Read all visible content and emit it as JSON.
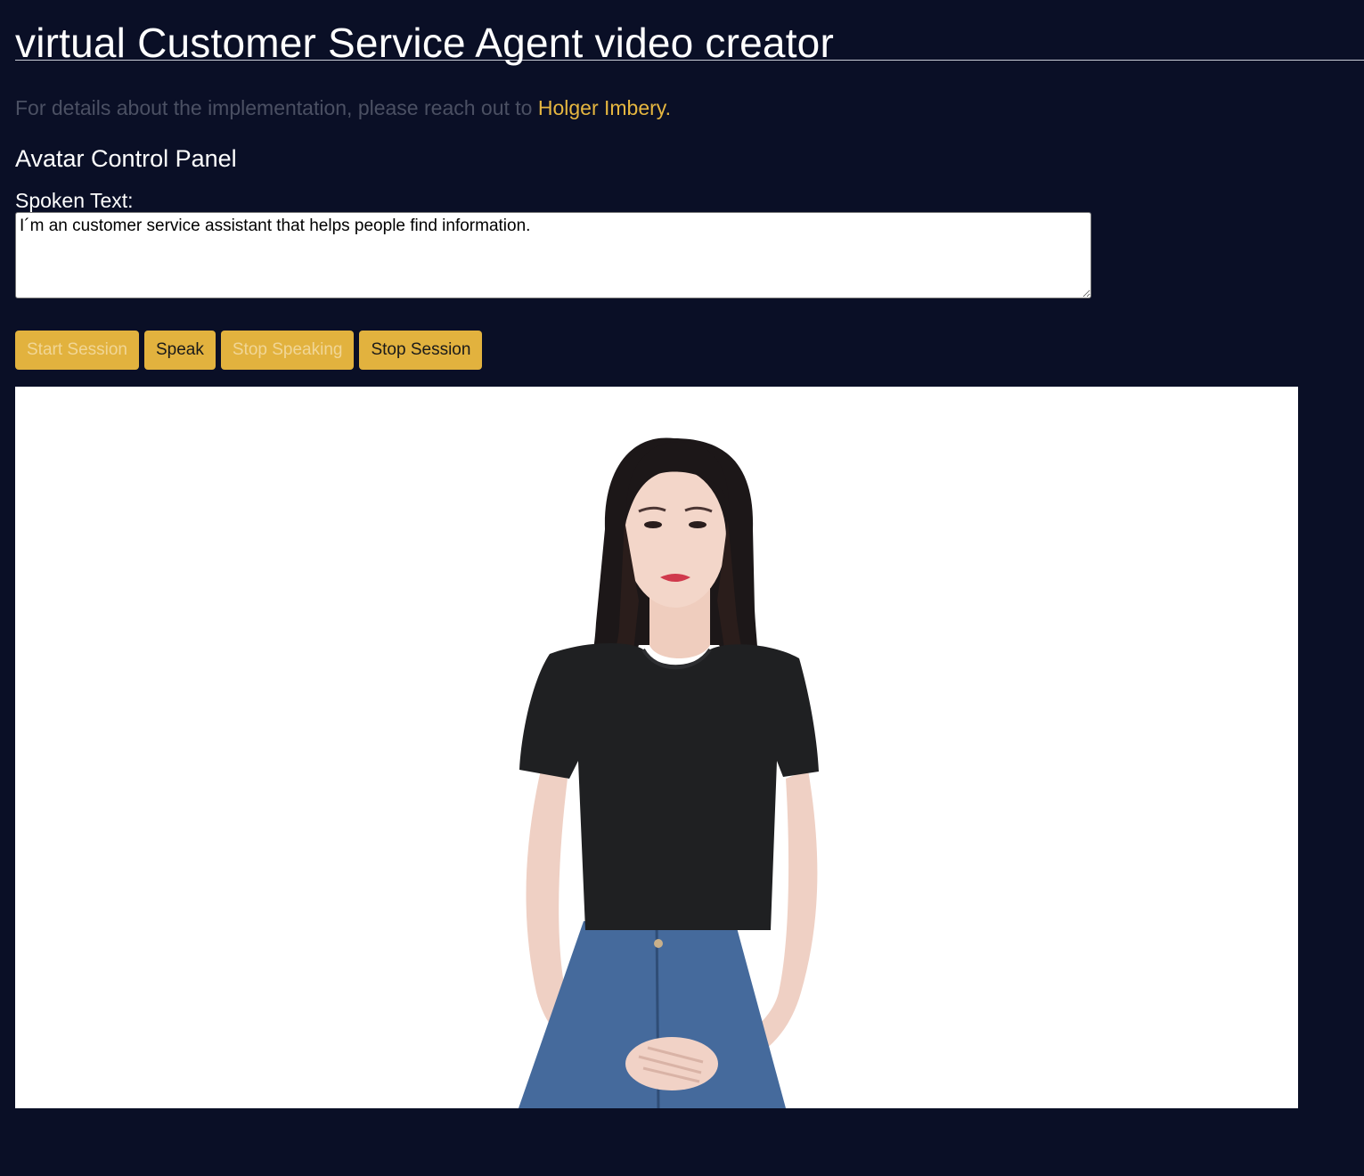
{
  "header": {
    "title": "virtual Customer Service Agent video creator"
  },
  "intro": {
    "text": "For details about the implementation, please reach out to ",
    "contact_name": "Holger Imbery."
  },
  "control_panel": {
    "heading": "Avatar Control Panel",
    "spoken_text_label": "Spoken Text:",
    "spoken_text_value": "I´m an customer service assistant that helps people find information."
  },
  "buttons": {
    "start_session": {
      "label": "Start Session",
      "enabled": false
    },
    "speak": {
      "label": "Speak",
      "enabled": true
    },
    "stop_speaking": {
      "label": "Stop Speaking",
      "enabled": false
    },
    "stop_session": {
      "label": "Stop Session",
      "enabled": true
    }
  },
  "video": {
    "content": "avatar-video",
    "background": "#ffffff"
  },
  "colors": {
    "page_background": "#0a0f26",
    "accent": "#e2b23e",
    "link": "#e6b740",
    "muted_text": "#4b5063"
  }
}
